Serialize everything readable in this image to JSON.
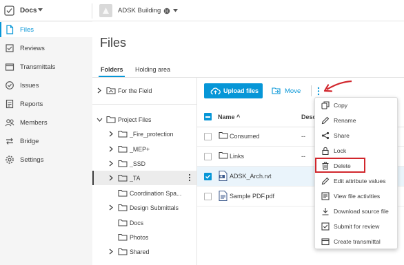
{
  "app": {
    "name": "Docs"
  },
  "project": {
    "name": "ADSK Building"
  },
  "nav": {
    "items": [
      {
        "label": "Files",
        "icon": "file-icon",
        "active": true
      },
      {
        "label": "Reviews",
        "icon": "review-icon"
      },
      {
        "label": "Transmittals",
        "icon": "transmittal-icon"
      },
      {
        "label": "Issues",
        "icon": "issue-icon"
      },
      {
        "label": "Reports",
        "icon": "report-icon"
      },
      {
        "label": "Members",
        "icon": "members-icon"
      },
      {
        "label": "Bridge",
        "icon": "bridge-icon"
      },
      {
        "label": "Settings",
        "icon": "gear-icon"
      }
    ]
  },
  "page": {
    "title": "Files"
  },
  "tabs": [
    {
      "label": "Folders",
      "active": true
    },
    {
      "label": "Holding area"
    }
  ],
  "tree": {
    "pinned": "For the Field",
    "root": "Project Files",
    "items": [
      {
        "label": "_Fire_protection"
      },
      {
        "label": "_MEP+"
      },
      {
        "label": "_SSD"
      },
      {
        "label": "_TA",
        "selected": true
      },
      {
        "label": "Coordination Spa..."
      },
      {
        "label": "Design Submittals"
      },
      {
        "label": "Docs"
      },
      {
        "label": "Photos"
      },
      {
        "label": "Shared"
      }
    ]
  },
  "toolbar": {
    "upload_label": "Upload files",
    "move_label": "Move"
  },
  "table": {
    "columns": {
      "name": "Name",
      "description": "Desc"
    },
    "rows": [
      {
        "name": "Consumed",
        "type": "folder",
        "description": "--",
        "checked": false
      },
      {
        "name": "Links",
        "type": "folder",
        "description": "--",
        "checked": false
      },
      {
        "name": "ADSK_Arch.rvt",
        "type": "rvt",
        "description": "",
        "checked": true
      },
      {
        "name": "Sample PDF.pdf",
        "type": "pdf",
        "description": "",
        "checked": false
      }
    ]
  },
  "menu": {
    "items": [
      {
        "label": "Copy",
        "icon": "copy-icon"
      },
      {
        "label": "Rename",
        "icon": "pencil-icon"
      },
      {
        "label": "Share",
        "icon": "share-icon"
      },
      {
        "label": "Lock",
        "icon": "lock-icon"
      },
      {
        "label": "Delete",
        "icon": "trash-icon",
        "highlighted": true
      },
      {
        "label": "Edit attribute values",
        "icon": "pencil-icon"
      },
      {
        "label": "View file activities",
        "icon": "activity-icon"
      },
      {
        "label": "Download source file",
        "icon": "download-icon"
      },
      {
        "label": "Submit for review",
        "icon": "review-icon"
      },
      {
        "label": "Create transmittal",
        "icon": "transmittal-icon"
      }
    ]
  },
  "colors": {
    "accent": "#0696d7",
    "annotation": "#d1262c",
    "nav_bg": "#f5f5f5"
  }
}
